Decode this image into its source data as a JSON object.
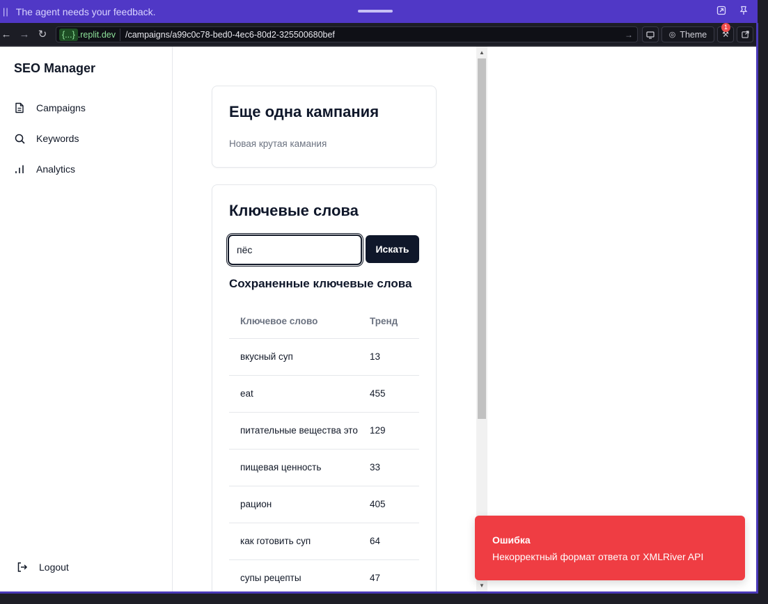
{
  "banner": {
    "message": "The agent needs your feedback."
  },
  "urlbar": {
    "host_braces": "{...}",
    "host": ".replit.dev",
    "path": "/campaigns/a99c0c78-bed0-4ec6-80d2-325500680bef",
    "theme_label": "Theme",
    "badge_count": "1"
  },
  "sidebar": {
    "brand": "SEO Manager",
    "items": [
      {
        "label": "Campaigns",
        "icon": "file-icon"
      },
      {
        "label": "Keywords",
        "icon": "search-icon"
      },
      {
        "label": "Analytics",
        "icon": "bar-chart-icon"
      }
    ],
    "logout_label": "Logout"
  },
  "campaign": {
    "title": "Еще одна кампания",
    "description": "Новая крутая камания"
  },
  "keywords_card": {
    "title": "Ключевые слова",
    "search_value": "пёс",
    "search_button": "Искать",
    "saved_title": "Сохраненные ключевые слова",
    "columns": [
      "Ключевое слово",
      "Тренд"
    ],
    "rows": [
      {
        "keyword": "вкусный суп",
        "trend": "13"
      },
      {
        "keyword": "eat",
        "trend": "455"
      },
      {
        "keyword": "питательные вещества это",
        "trend": "129"
      },
      {
        "keyword": "пищевая ценность",
        "trend": "33"
      },
      {
        "keyword": "рацион",
        "trend": "405"
      },
      {
        "keyword": "как готовить суп",
        "trend": "64"
      },
      {
        "keyword": "супы рецепты",
        "trend": "47"
      }
    ]
  },
  "toast": {
    "title": "Ошибка",
    "message": "Некорректный формат ответа от XMLRiver API",
    "color": "#ef3d43"
  }
}
